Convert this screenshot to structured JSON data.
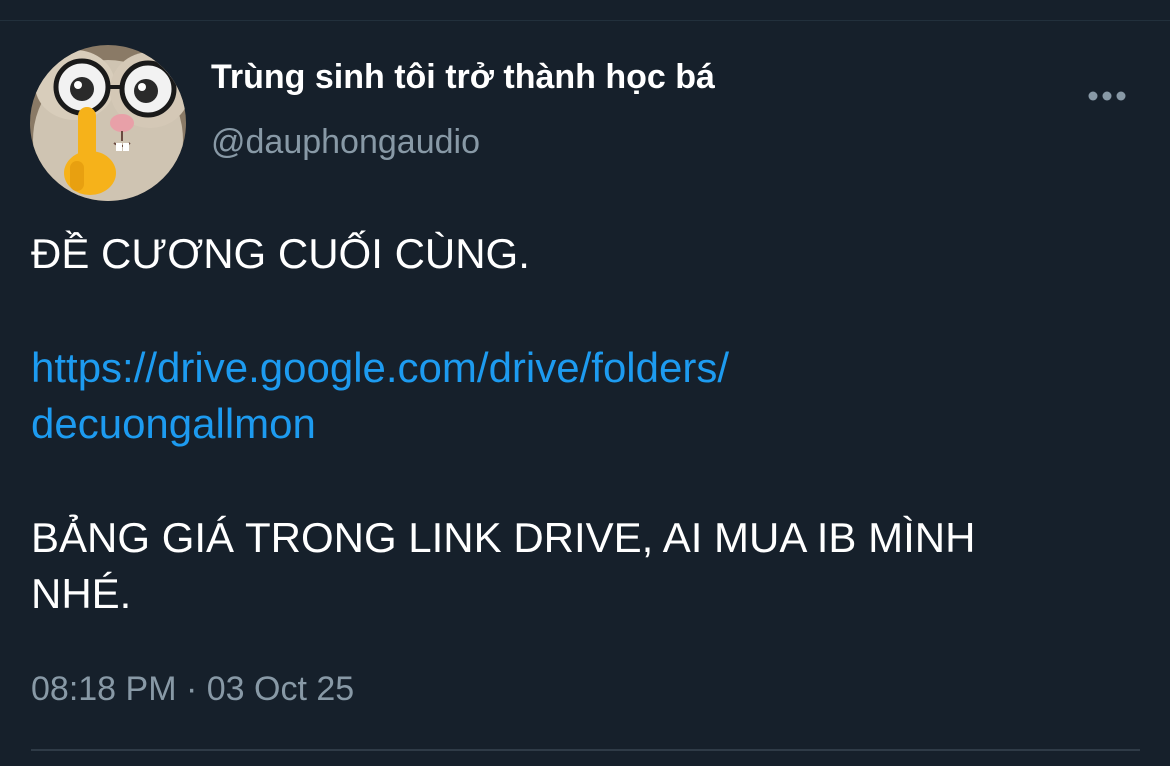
{
  "tweet": {
    "display_name": "Trùng sinh tôi trở thành học bá",
    "handle": "@dauphongaudio",
    "avatar_icon": "cat-with-glasses-avatar",
    "more_icon": "more-options-icon",
    "text_line_1": "ĐỀ CƯƠNG CUỐI CÙNG.",
    "link_line_1": "https://drive.google.com/drive/folders/",
    "link_line_2": "decuongallmon",
    "text_line_3": "BẢNG GIÁ TRONG LINK DRIVE, AI MUA IB MÌNH",
    "text_line_4": "NHÉ.",
    "timestamp": "08:18 PM · 03 Oct 25"
  },
  "colors": {
    "background": "#16202b",
    "link": "#1d9bf0",
    "secondary_text": "#8899a6"
  }
}
